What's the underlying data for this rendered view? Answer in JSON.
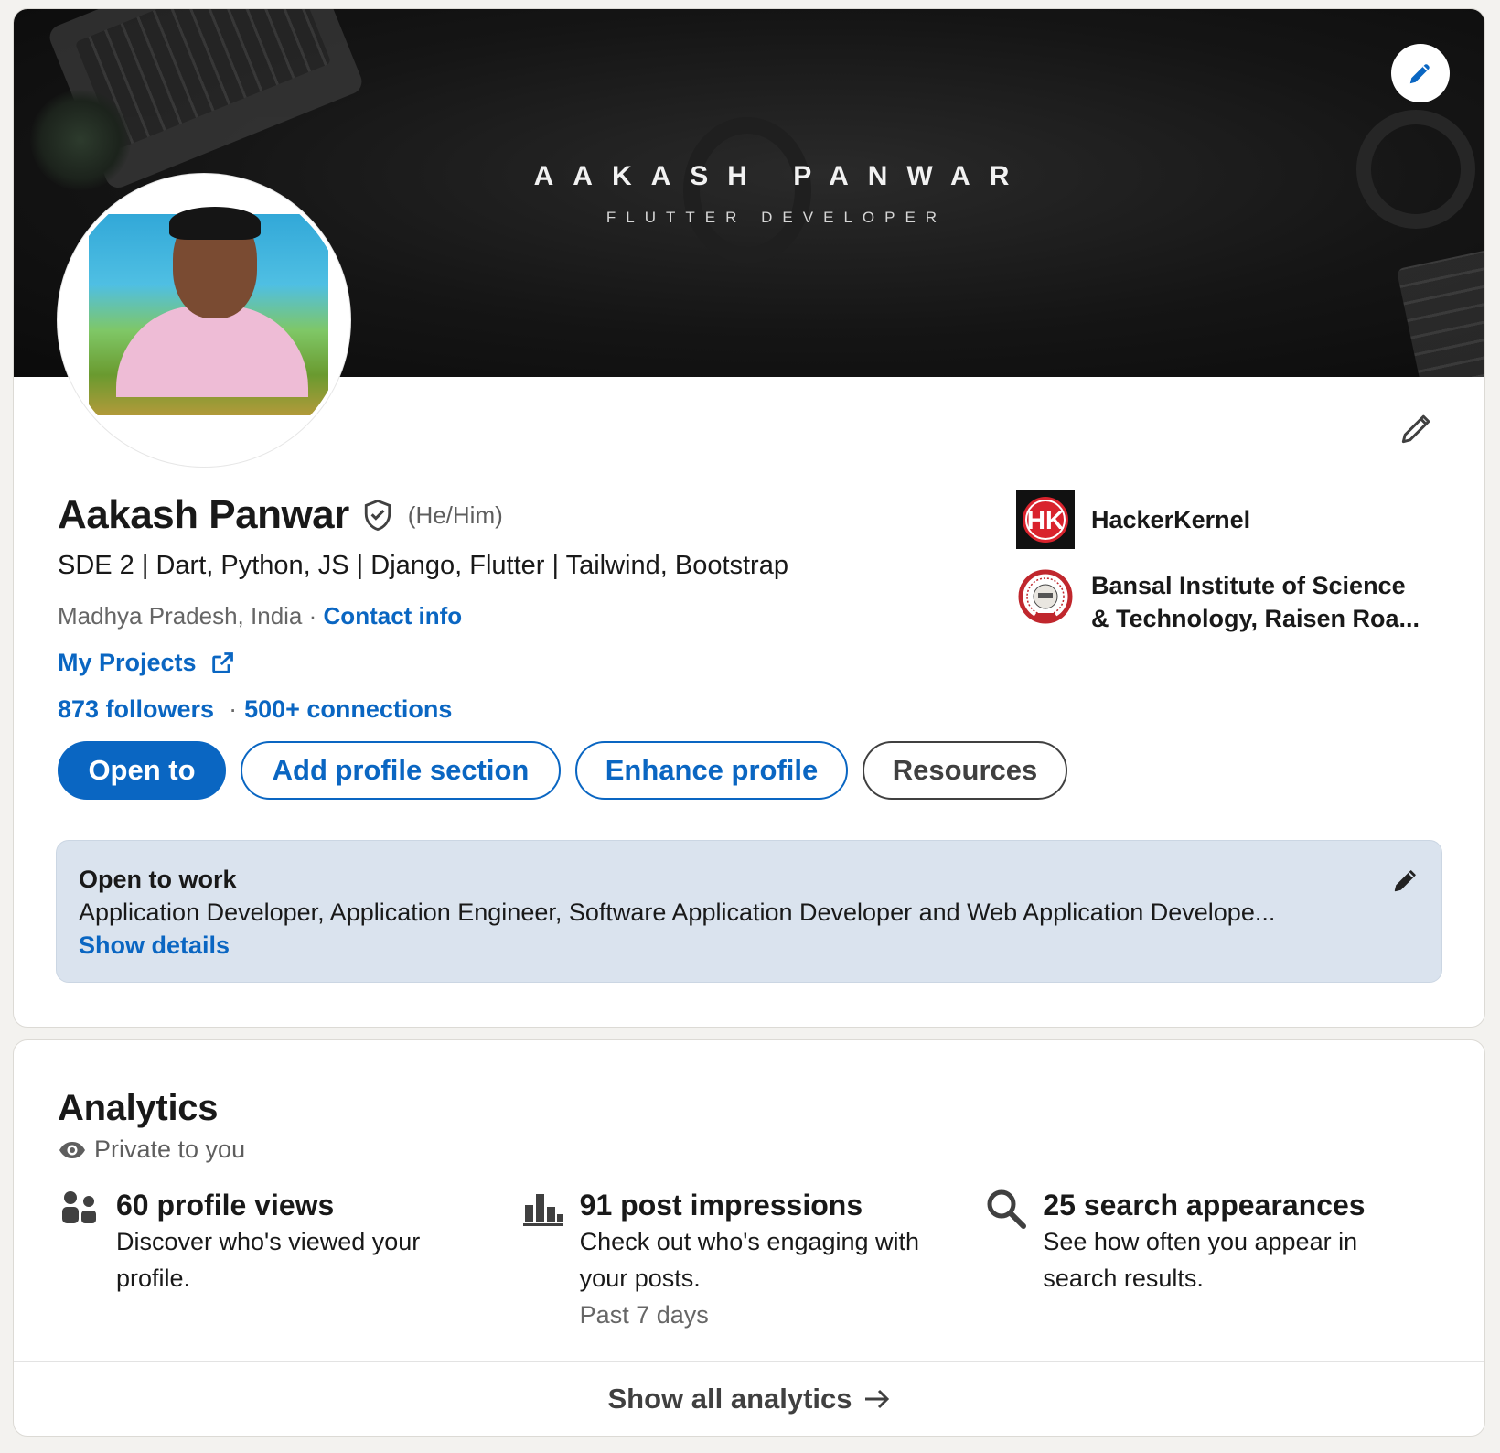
{
  "banner": {
    "title": "AAKASH PANWAR",
    "subtitle": "FLUTTER DEVELOPER"
  },
  "profile": {
    "name": "Aakash Panwar",
    "pronouns": "(He/Him)",
    "headline": "SDE 2 | Dart, Python, JS | Django, Flutter | Tailwind, Bootstrap",
    "location": "Madhya Pradesh, India",
    "separator": "·",
    "contact_info": "Contact info",
    "projects_link": "My Projects",
    "followers": "873 followers",
    "connections": "500+ connections"
  },
  "buttons": {
    "open_to": "Open to",
    "add_section": "Add profile section",
    "enhance": "Enhance profile",
    "resources": "Resources"
  },
  "orgs": [
    {
      "name": "HackerKernel",
      "logo_text": "HK"
    },
    {
      "name_line1": "Bansal Institute of Science",
      "name_line2": "& Technology, Raisen Roa..."
    }
  ],
  "open_to_work": {
    "title": "Open to work",
    "roles": "Application Developer, Application Engineer, Software Application Developer and Web Application Develope...",
    "link": "Show details"
  },
  "analytics": {
    "title": "Analytics",
    "privacy": "Private to you",
    "items": [
      {
        "metric": "60 profile views",
        "desc": "Discover who's viewed your profile.",
        "icon": "people-icon"
      },
      {
        "metric": "91 post impressions",
        "desc": "Check out who's engaging with your posts.",
        "note": "Past 7 days",
        "icon": "bar-chart-icon"
      },
      {
        "metric": "25 search appearances",
        "desc": "See how often you appear in search results.",
        "icon": "search-icon"
      }
    ],
    "footer": "Show all analytics"
  },
  "colors": {
    "accent": "#0a66c2",
    "page_bg": "#f3f2ef",
    "otw_bg": "#dae3ee"
  }
}
